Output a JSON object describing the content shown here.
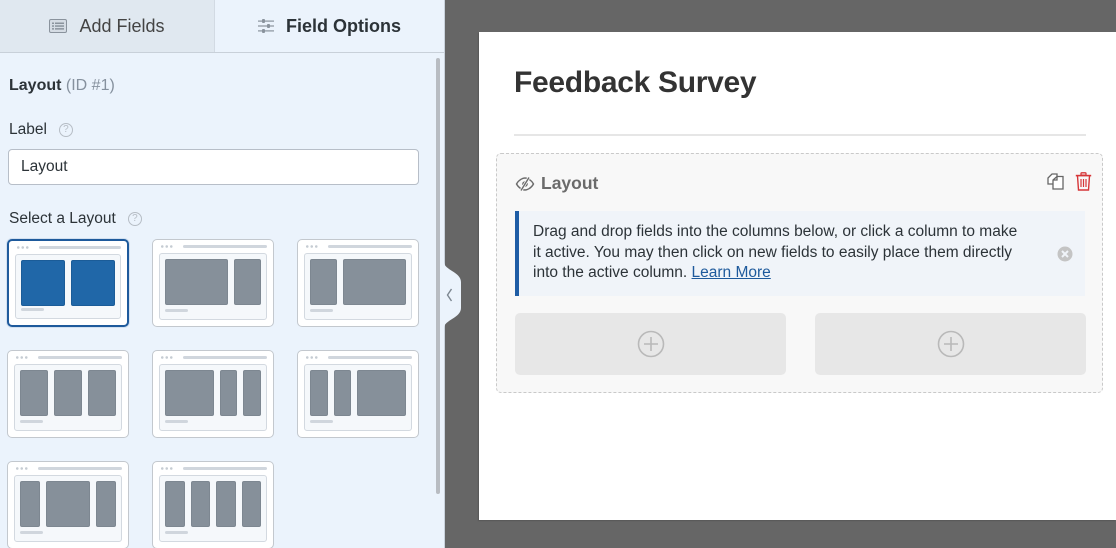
{
  "left_panel": {
    "tabs": [
      {
        "label": "Add Fields",
        "icon": "list-icon",
        "active": false
      },
      {
        "label": "Field Options",
        "icon": "sliders-icon",
        "active": true
      }
    ],
    "field_title": "Layout",
    "field_id": "(ID #1)",
    "label_field": {
      "label": "Label",
      "value": "Layout",
      "help_icon": "question-icon"
    },
    "select_layout": {
      "label": "Select a Layout",
      "help_icon": "question-icon",
      "options": [
        {
          "name": "50/50",
          "columns": [
            1,
            1
          ],
          "selected": true
        },
        {
          "name": "67/33",
          "columns": [
            2.4,
            1
          ],
          "selected": false
        },
        {
          "name": "33/67",
          "columns": [
            1,
            2.4
          ],
          "selected": false
        },
        {
          "name": "33/33/33",
          "columns": [
            1,
            1,
            1
          ],
          "selected": false
        },
        {
          "name": "50/25/25",
          "columns": [
            2.4,
            0.8,
            0.8
          ],
          "selected": false
        },
        {
          "name": "25/25/50",
          "columns": [
            0.8,
            0.8,
            2.4
          ],
          "selected": false
        },
        {
          "name": "25/50/25",
          "columns": [
            0.9,
            2.2,
            0.9
          ],
          "selected": false
        },
        {
          "name": "25/25/25/25",
          "columns": [
            1,
            1,
            1,
            1
          ],
          "selected": false
        }
      ]
    },
    "collapse_icon": "chevron-left-icon"
  },
  "preview": {
    "form_title": "Feedback Survey",
    "field": {
      "title": "Layout",
      "hidden_icon": "eye-slash-icon",
      "actions": [
        "duplicate-icon",
        "trash-icon"
      ],
      "notice": {
        "text": "Drag and drop fields into the columns below, or click a column to make it active. You may then click on new fields to easily place them directly into the active column.",
        "link": "Learn More"
      },
      "column_count": 2
    }
  },
  "colors": {
    "accent": "#1f5da5",
    "selected_layout": "#2067a8",
    "unselected_layout": "#86909a",
    "delete": "#d63638",
    "panel_bg": "#ebf3fc",
    "canvas_bg": "#666666"
  }
}
